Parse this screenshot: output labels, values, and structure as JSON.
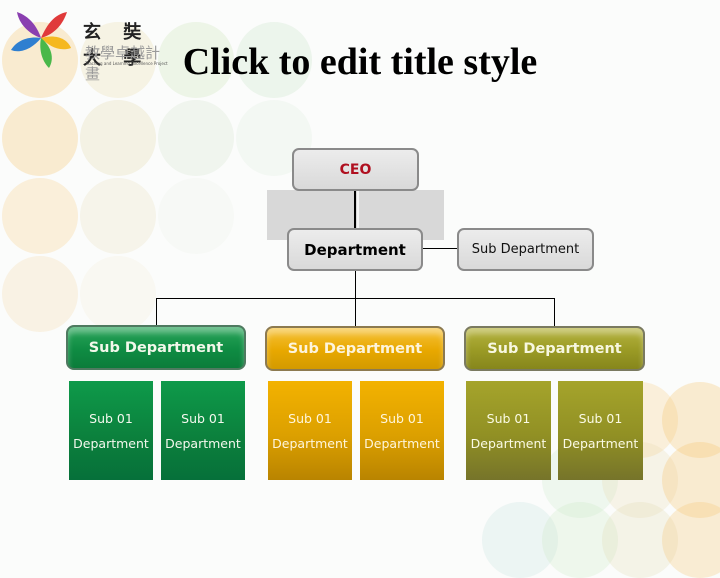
{
  "slide": {
    "title": "Click to edit title style",
    "logo": {
      "name_cn_top": "玄 奘 大 學",
      "name_cn_bottom": "教學卓越計畫",
      "name_en": "Teaching and Learning Excellence Project",
      "petal_colors": [
        "#e03a3a",
        "#f5b820",
        "#4ab84a",
        "#2f7fd0",
        "#8a3fb0"
      ]
    }
  },
  "org_chart": {
    "ceo": {
      "label": "CEO"
    },
    "department": {
      "label": "Department"
    },
    "side_sub_department": {
      "label": "Sub Department"
    },
    "groups": [
      {
        "label": "Sub Department",
        "color": "#0f8c43",
        "units": [
          {
            "line1": "Sub 01",
            "line2": "Department"
          },
          {
            "line1": "Sub 01",
            "line2": "Department"
          }
        ]
      },
      {
        "label": "Sub Department",
        "color": "#e8a800",
        "units": [
          {
            "line1": "Sub 01",
            "line2": "Department"
          },
          {
            "line1": "Sub 01",
            "line2": "Department"
          }
        ]
      },
      {
        "label": "Sub Department",
        "color": "#9a9a25",
        "units": [
          {
            "line1": "Sub 01",
            "line2": "Department"
          },
          {
            "line1": "Sub 01",
            "line2": "Department"
          }
        ]
      }
    ]
  }
}
